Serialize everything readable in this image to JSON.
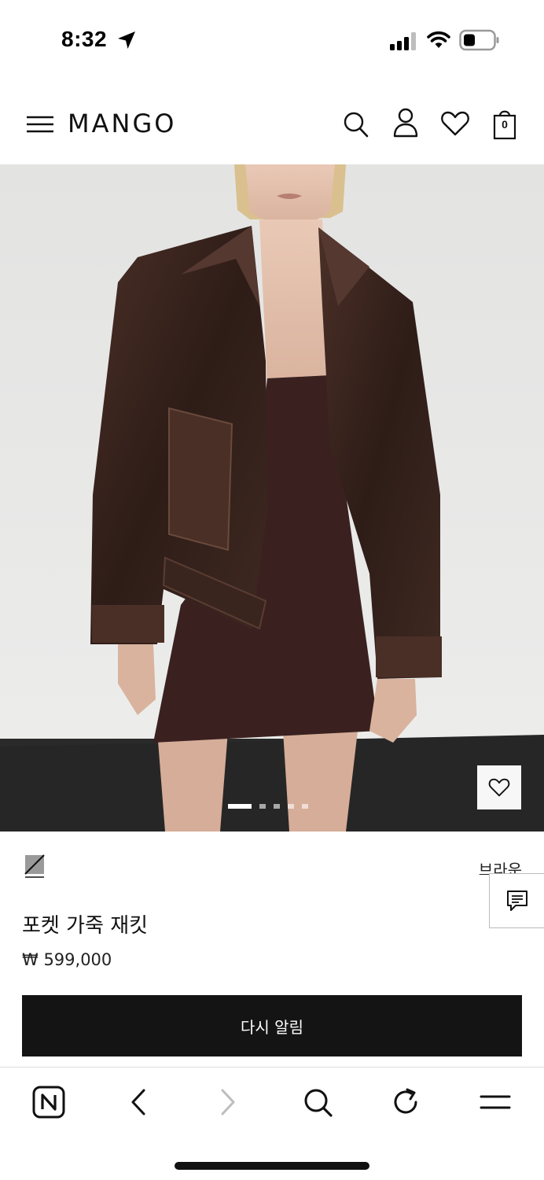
{
  "status_bar": {
    "time": "8:32",
    "icons": [
      "location-arrow-icon",
      "signal-icon",
      "wifi-icon",
      "battery-icon"
    ]
  },
  "header": {
    "logo": "MANGO",
    "icons": [
      "menu-icon",
      "search-icon",
      "account-icon",
      "heart-icon",
      "bag-icon"
    ],
    "bag_count": "0"
  },
  "gallery": {
    "image_count": 5,
    "active_index": 0
  },
  "product": {
    "color": "브라운",
    "name": "포켓 가죽 재킷",
    "price": "₩ 599,000",
    "notify_label": "다시 알림"
  },
  "browser_toolbar": {
    "icons": [
      "naver-icon",
      "back-icon",
      "forward-icon",
      "search-icon",
      "reload-icon",
      "menu-icon"
    ]
  },
  "colors": {
    "button_bg": "#141414",
    "jacket": "#3b2620",
    "dress": "#3a2120"
  }
}
